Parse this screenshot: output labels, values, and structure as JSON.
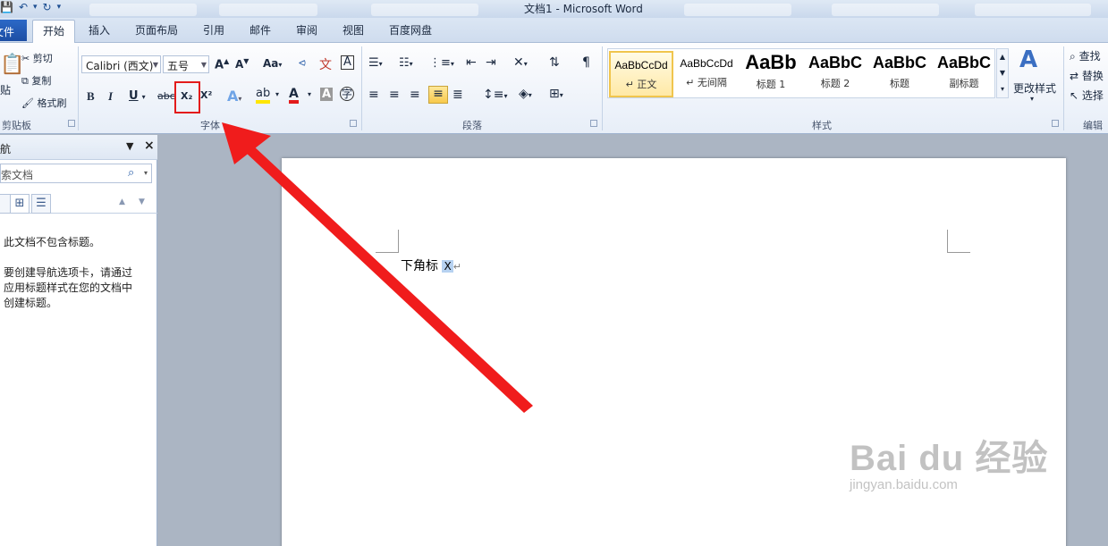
{
  "window": {
    "title": "文档1 - Microsoft Word"
  },
  "qat": {
    "save_icon": "save-icon",
    "undo_icon": "undo-icon",
    "redo_icon": "redo-icon",
    "customize_icon": "qat-dropdown-icon"
  },
  "ribbon_tabs": {
    "file": "文件",
    "items": [
      "开始",
      "插入",
      "页面布局",
      "引用",
      "邮件",
      "审阅",
      "视图",
      "百度网盘"
    ]
  },
  "clipboard": {
    "paste": "贴",
    "cut": "剪切",
    "copy": "复制",
    "format_painter": "格式刷",
    "label": "剪贴板"
  },
  "font": {
    "family": "Calibri (西文)",
    "size": "五号",
    "label": "字体",
    "bold": "B",
    "italic": "I",
    "underline": "U",
    "strike": "abc",
    "subscript": "X₂",
    "superscript": "X²",
    "grow": "A",
    "shrink": "A",
    "change_case": "Aa",
    "clear_format": "A",
    "font_color": "A",
    "char_shading": "A",
    "enclose": "字"
  },
  "paragraph": {
    "label": "段落"
  },
  "styles": {
    "label": "样式",
    "items": [
      {
        "sample": "AaBbCcDd",
        "name": "正文"
      },
      {
        "sample": "AaBbCcDd",
        "name": "无间隔"
      },
      {
        "sample": "AaBb",
        "name": "标题 1"
      },
      {
        "sample": "AaBbC",
        "name": "标题 2"
      },
      {
        "sample": "AaBbC",
        "name": "标题"
      },
      {
        "sample": "AaBbC",
        "name": "副标题"
      }
    ],
    "change_styles": "更改样式"
  },
  "editing": {
    "label": "编辑",
    "find": "查找",
    "replace": "替换",
    "select": "选择"
  },
  "nav_pane": {
    "title": "航",
    "search_placeholder": "索文档",
    "message1": "此文档不包含标题。",
    "message2_lines": [
      "要创建导航选项卡，请通过",
      "应用标题样式在您的文档中",
      "创建标题。"
    ]
  },
  "document": {
    "text": "下角标",
    "selected": "X"
  },
  "watermark": {
    "main": "Bai du 经验",
    "sub": "jingyan.baidu.com"
  },
  "colors": {
    "accent_red": "#e31b1b",
    "selection": "#b7d2f1",
    "file_tab": "#1d4ea4"
  }
}
